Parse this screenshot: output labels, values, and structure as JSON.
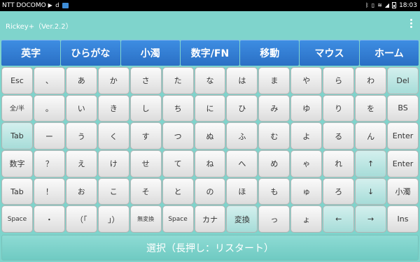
{
  "status": {
    "carrier": "NTT DOCOMO",
    "time": "18:03"
  },
  "app": {
    "title": "Rickey+（Ver.2.2）"
  },
  "tabs": [
    "英字",
    "ひらがな",
    "小濁",
    "数字/FN",
    "移動",
    "マウス",
    "ホーム"
  ],
  "keys": [
    [
      {
        "label": "Esc",
        "teal": false
      },
      {
        "label": "、",
        "teal": false
      },
      {
        "label": "あ",
        "teal": false
      },
      {
        "label": "か",
        "teal": false
      },
      {
        "label": "さ",
        "teal": false
      },
      {
        "label": "た",
        "teal": false
      },
      {
        "label": "な",
        "teal": false
      },
      {
        "label": "は",
        "teal": false
      },
      {
        "label": "ま",
        "teal": false
      },
      {
        "label": "や",
        "teal": false
      },
      {
        "label": "ら",
        "teal": false
      },
      {
        "label": "わ",
        "teal": false
      },
      {
        "label": "Del",
        "teal": true
      }
    ],
    [
      {
        "label": "全/半",
        "teal": false
      },
      {
        "label": "。",
        "teal": false
      },
      {
        "label": "い",
        "teal": false
      },
      {
        "label": "き",
        "teal": false
      },
      {
        "label": "し",
        "teal": false
      },
      {
        "label": "ち",
        "teal": false
      },
      {
        "label": "に",
        "teal": false
      },
      {
        "label": "ひ",
        "teal": false
      },
      {
        "label": "み",
        "teal": false
      },
      {
        "label": "ゆ",
        "teal": false
      },
      {
        "label": "り",
        "teal": false
      },
      {
        "label": "を",
        "teal": false
      },
      {
        "label": "BS",
        "teal": false
      }
    ],
    [
      {
        "label": "Tab",
        "teal": true
      },
      {
        "label": "ー",
        "teal": false
      },
      {
        "label": "う",
        "teal": false
      },
      {
        "label": "く",
        "teal": false
      },
      {
        "label": "す",
        "teal": false
      },
      {
        "label": "つ",
        "teal": false
      },
      {
        "label": "ぬ",
        "teal": false
      },
      {
        "label": "ふ",
        "teal": false
      },
      {
        "label": "む",
        "teal": false
      },
      {
        "label": "よ",
        "teal": false
      },
      {
        "label": "る",
        "teal": false
      },
      {
        "label": "ん",
        "teal": false
      },
      {
        "label": "Enter",
        "teal": false
      }
    ],
    [
      {
        "label": "数字",
        "teal": false
      },
      {
        "label": "？",
        "teal": false
      },
      {
        "label": "え",
        "teal": false
      },
      {
        "label": "け",
        "teal": false
      },
      {
        "label": "せ",
        "teal": false
      },
      {
        "label": "て",
        "teal": false
      },
      {
        "label": "ね",
        "teal": false
      },
      {
        "label": "へ",
        "teal": false
      },
      {
        "label": "め",
        "teal": false
      },
      {
        "label": "ゃ",
        "teal": false
      },
      {
        "label": "れ",
        "teal": false
      },
      {
        "label": "↑",
        "teal": true
      },
      {
        "label": "Enter",
        "teal": false
      }
    ],
    [
      {
        "label": "Tab",
        "teal": false
      },
      {
        "label": "！",
        "teal": false
      },
      {
        "label": "お",
        "teal": false
      },
      {
        "label": "こ",
        "teal": false
      },
      {
        "label": "そ",
        "teal": false
      },
      {
        "label": "と",
        "teal": false
      },
      {
        "label": "の",
        "teal": false
      },
      {
        "label": "ほ",
        "teal": false
      },
      {
        "label": "も",
        "teal": false
      },
      {
        "label": "ゅ",
        "teal": false
      },
      {
        "label": "ろ",
        "teal": false
      },
      {
        "label": "↓",
        "teal": true
      },
      {
        "label": "小濁",
        "teal": false
      }
    ],
    [
      {
        "label": "Space",
        "teal": false
      },
      {
        "label": "・",
        "teal": false
      },
      {
        "label": "（「",
        "teal": false
      },
      {
        "label": "」）",
        "teal": false
      },
      {
        "label": "無変換",
        "teal": false
      },
      {
        "label": "Space",
        "teal": false
      },
      {
        "label": "カナ",
        "teal": false
      },
      {
        "label": "変換",
        "teal": true
      },
      {
        "label": "っ",
        "teal": false
      },
      {
        "label": "ょ",
        "teal": false
      },
      {
        "label": "←",
        "teal": true
      },
      {
        "label": "→",
        "teal": true
      },
      {
        "label": "Ins",
        "teal": false
      }
    ]
  ],
  "bottom_button": "選択（長押し：リスタート）"
}
